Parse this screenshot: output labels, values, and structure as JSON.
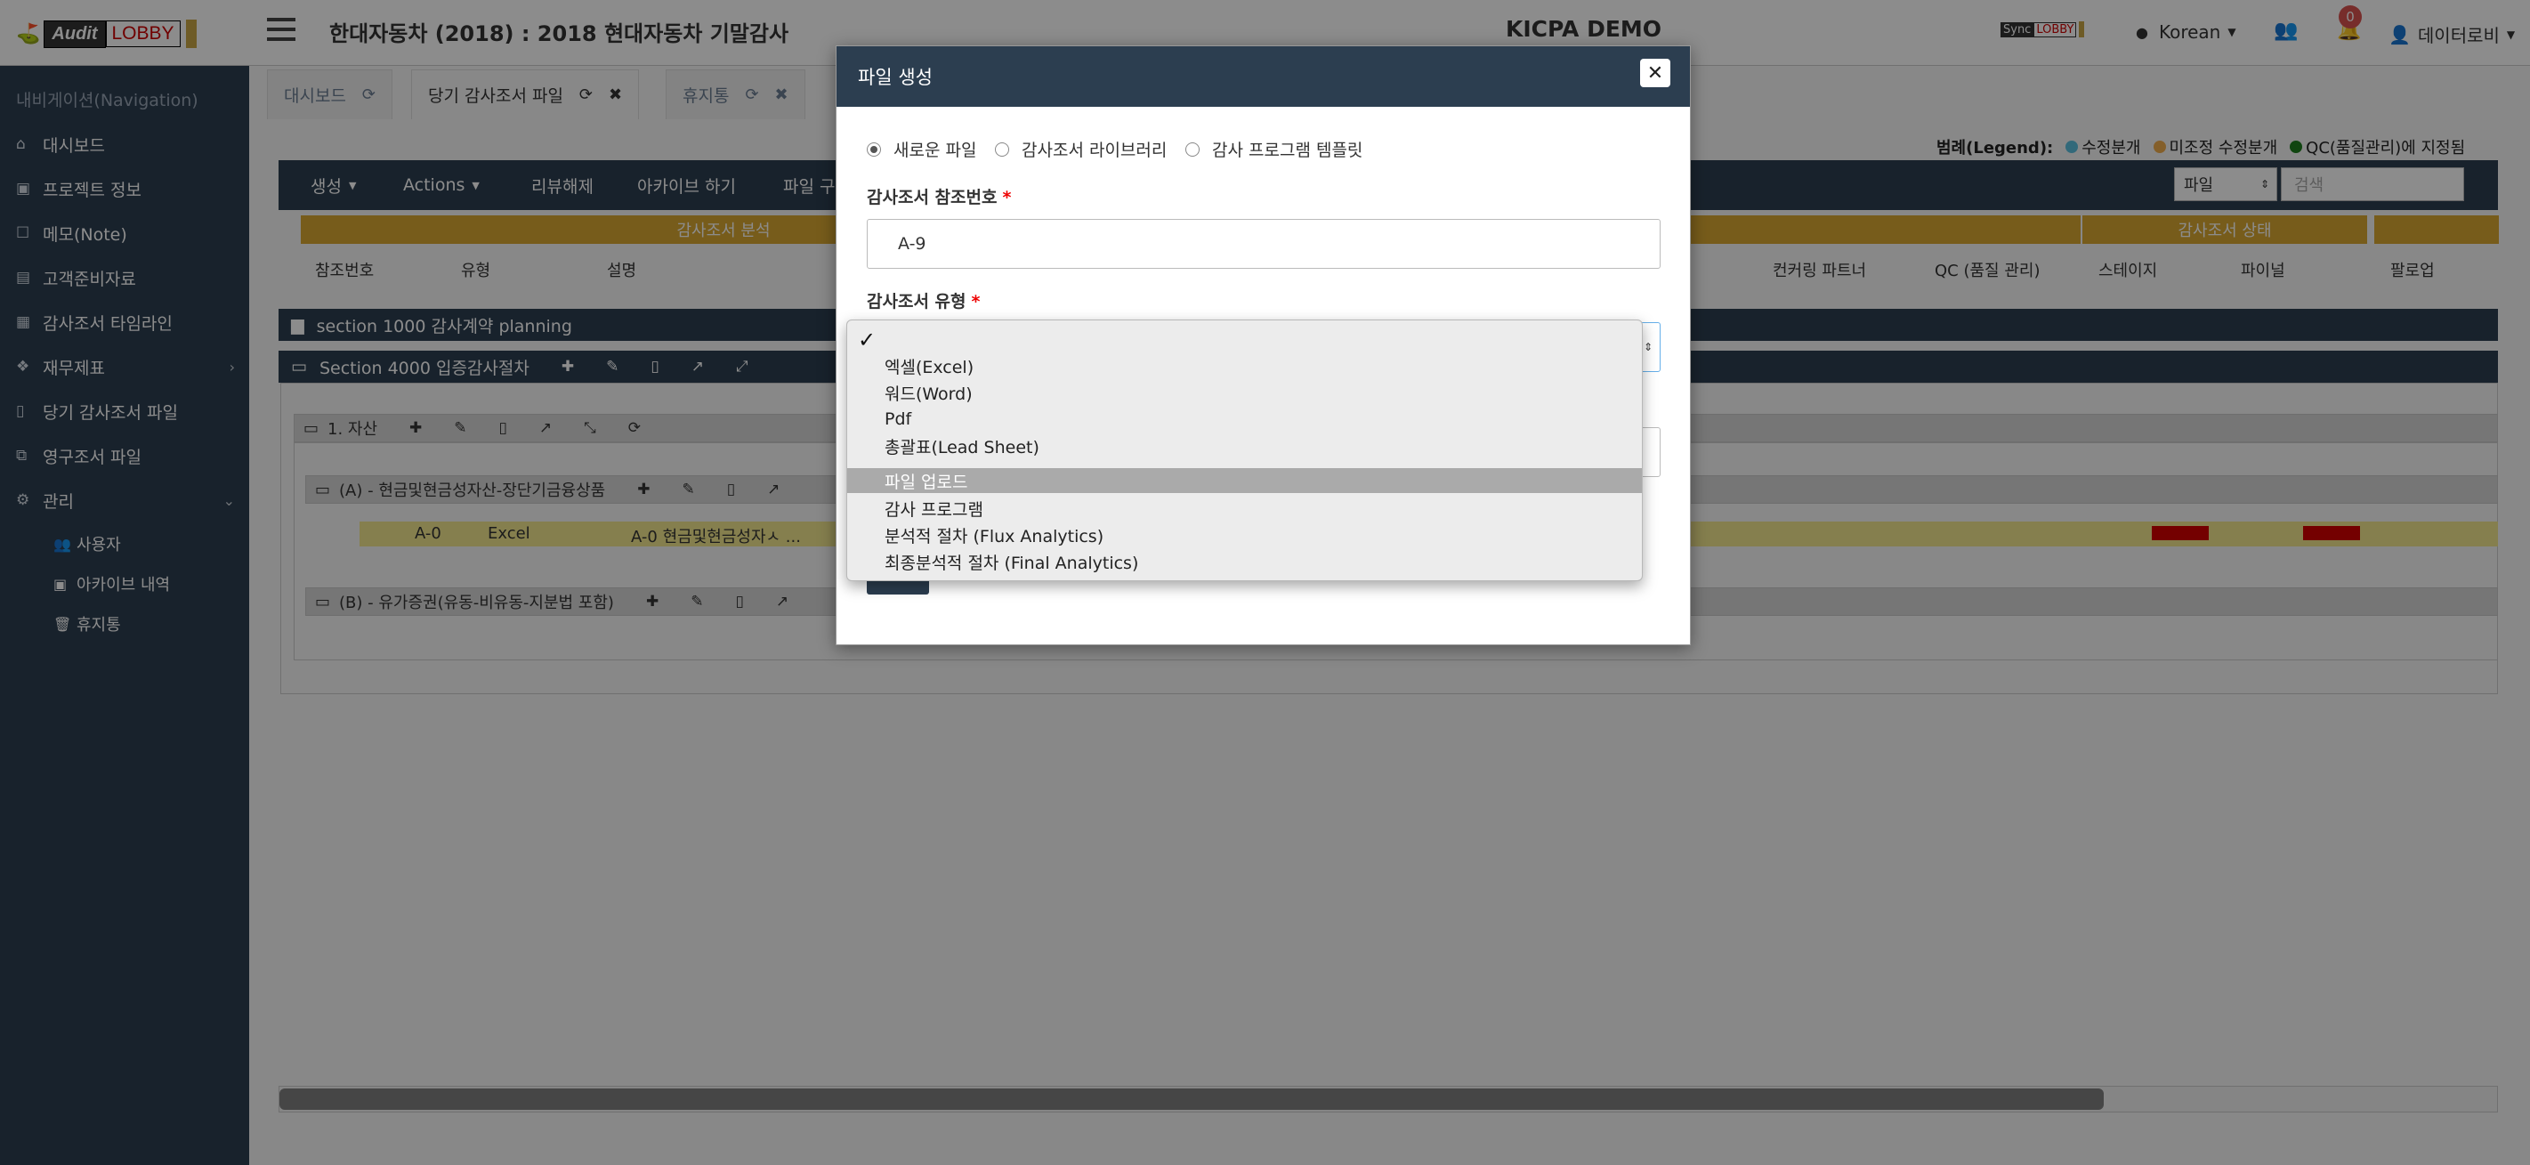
{
  "header": {
    "logo_text_audit": "Audit",
    "logo_text_lobby": "LOBBY",
    "title": "한대자동차 (2018) : 2018 현대자동차 기말감사",
    "center": "KICPA DEMO",
    "sync": "Sync",
    "sync_lobby": "LOBBY",
    "language": "Korean",
    "notification_count": "0",
    "user": "데이터로비"
  },
  "sidebar": {
    "heading": "내비게이션(Navigation)",
    "items": [
      {
        "label": "대시보드",
        "icon": "home-icon"
      },
      {
        "label": "프로젝트 정보",
        "icon": "id-card-icon"
      },
      {
        "label": "메모(Note)",
        "icon": "note-icon"
      },
      {
        "label": "고객준비자료",
        "icon": "table-icon"
      },
      {
        "label": "감사조서 타임라인",
        "icon": "calendar-icon"
      },
      {
        "label": "재무제표",
        "icon": "cubes-icon"
      },
      {
        "label": "당기 감사조서 파일",
        "icon": "file-icon"
      },
      {
        "label": "영구조서 파일",
        "icon": "clone-icon"
      },
      {
        "label": "관리",
        "icon": "gear-icon"
      }
    ],
    "subitems": [
      {
        "label": "사용자",
        "icon": "users-icon"
      },
      {
        "label": "아카이브 내역",
        "icon": "archive-icon"
      },
      {
        "label": "휴지통",
        "icon": "trash-icon"
      }
    ]
  },
  "tabs": [
    {
      "label": "대시보드"
    },
    {
      "label": "당기 감사조서 파일"
    },
    {
      "label": "휴지통"
    }
  ],
  "legend": {
    "title": "범례(Legend):",
    "items": [
      {
        "label": "수정분개",
        "color": "#5bc0de"
      },
      {
        "label": "미조정 수정분개",
        "color": "#f0ad4e"
      },
      {
        "label": "QC(품질관리)에 지정됨",
        "color": "#1e7e1e"
      }
    ]
  },
  "toolbar": {
    "buttons": [
      "생성",
      "Actions",
      "리뷰해제",
      "아카이브 하기",
      "파일 구"
    ],
    "select_value": "파일",
    "search_placeholder": "검색"
  },
  "columns": {
    "group_left": "감사조서 분석",
    "group_right": "감사조서 상태",
    "left": [
      "참조번호",
      "유형",
      "설명"
    ],
    "right": [
      "컨커링 파트너",
      "QC (품질 관리)",
      "스테이지",
      "파이널",
      "팔로업"
    ]
  },
  "sections": {
    "s1": "section 1000 감사계약 planning",
    "s2": "Section 4000 입증감사절차",
    "g1": "1. 자산",
    "g2": "(A) - 현금및현금성자산-장단기금융상품",
    "g3": "(B) - 유가증권(유동-비유동-지분법 포함)"
  },
  "row": {
    "ref": "A-0",
    "type": "Excel",
    "desc": "A-0 현금및현금성자ㅅ ..."
  },
  "modal": {
    "title": "파일 생성",
    "radios": [
      "새로운 파일",
      "감사조서 라이브러리",
      "감사 프로그램 템플릿"
    ],
    "ref_label": "감사조서 참조번호",
    "ref_value": "A-9",
    "type_label": "감사조서 유형",
    "required": "*"
  },
  "dropdown": {
    "check": "✓",
    "options": [
      "엑셀(Excel)",
      "워드(Word)",
      "Pdf",
      "총괄표(Lead Sheet)",
      "파일 업로드",
      "감사 프로그램",
      "분석적 절차 (Flux Analytics)",
      "최종분석적 절차 (Final Analytics)"
    ],
    "selected_index": 4
  }
}
